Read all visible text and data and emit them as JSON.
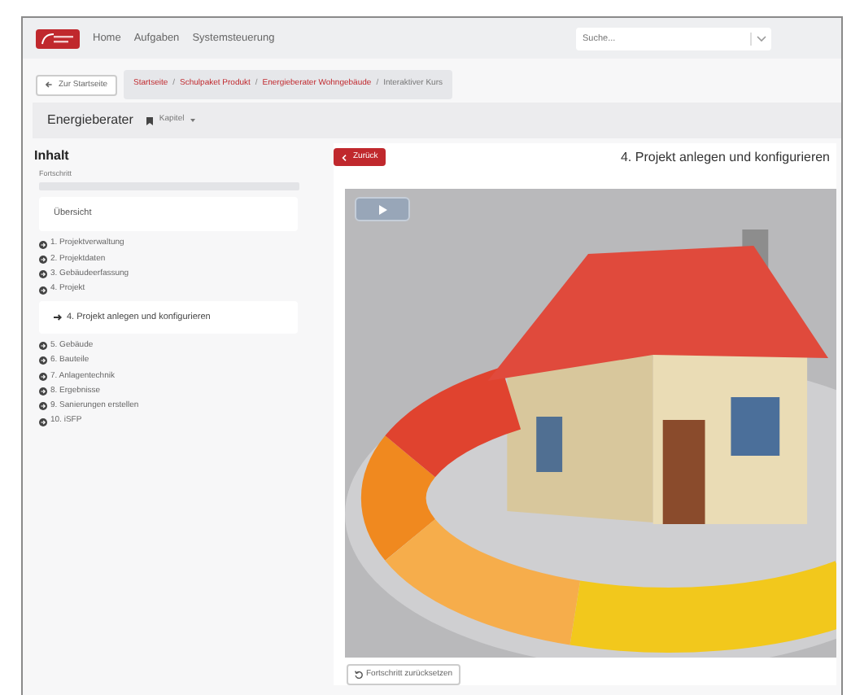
{
  "navbar": {
    "links": [
      "Home",
      "Aufgaben",
      "Systemsteuerung"
    ],
    "search": {
      "placeholder": "Suche..."
    }
  },
  "breadcrumb_bar": {
    "back_button": "Zur Startseite",
    "separator": "/",
    "crumbs": [
      {
        "label": "Startseite",
        "selected": false
      },
      {
        "label": "Schulpaket Produkt",
        "selected": false
      },
      {
        "label": "Energieberater Wohngebäude",
        "selected": false
      },
      {
        "label": "Interaktiver Kurs",
        "selected": true
      }
    ]
  },
  "course_header": {
    "title": "Energieberater",
    "chapter_menu": "Kapitel"
  },
  "sidebar": {
    "heading": "Inhalt",
    "progress": {
      "label": "Fortschritt",
      "level": 0
    },
    "overview": "Übersicht",
    "chapters": [
      {
        "label": "1. Projektverwaltung"
      },
      {
        "label": "2. Projektdaten"
      },
      {
        "label": "3. Gebäudeerfassung"
      },
      {
        "label": "4. Projekt",
        "children": [
          {
            "label": "4. Projekt anlegen und konfigurieren",
            "selected": true
          }
        ]
      },
      {
        "label": "5. Gebäude"
      },
      {
        "label": "6. Bauteile"
      },
      {
        "label": "7. Anlagentechnik"
      },
      {
        "label": "8. Ergebnisse"
      },
      {
        "label": "9. Sanierungen erstellen"
      },
      {
        "label": "10. iSFP"
      }
    ]
  },
  "lesson": {
    "back_button": "Zurück",
    "title": "4. Projekt anlegen und konfigurieren",
    "reset_button": "Fortschritt zurücksetzen"
  }
}
